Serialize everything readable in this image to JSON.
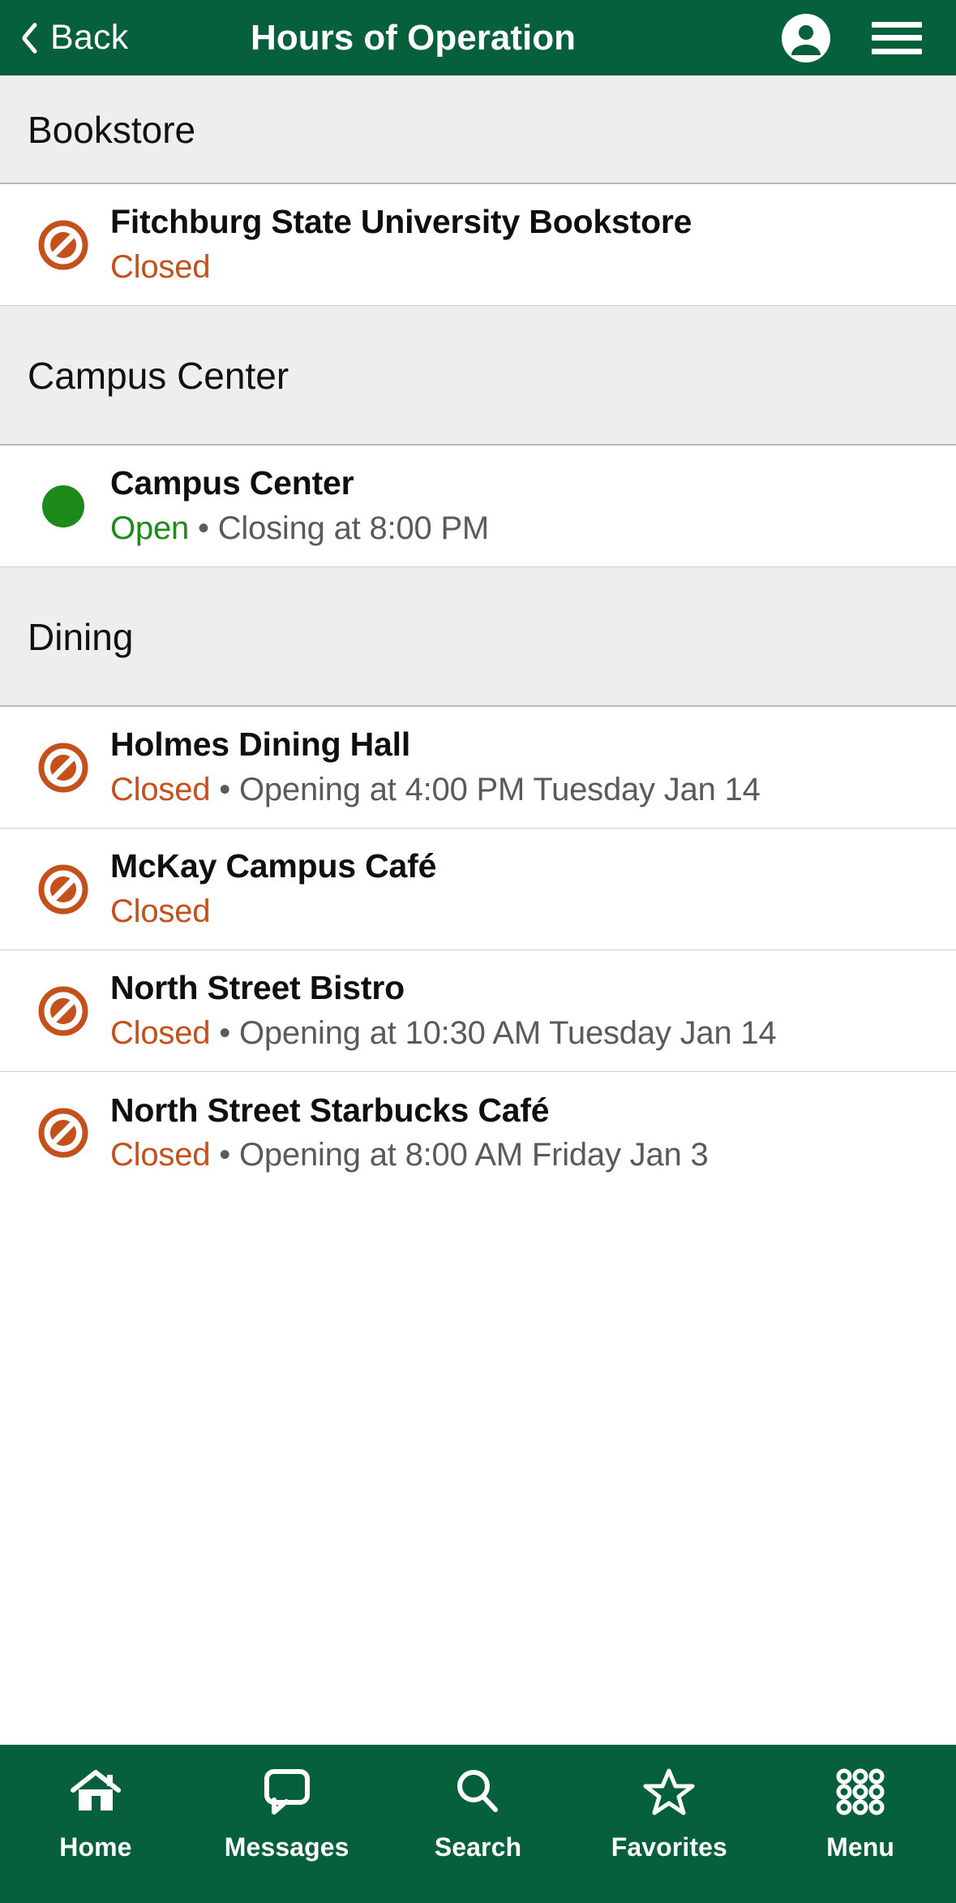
{
  "header": {
    "back_label": "Back",
    "title": "Hours of Operation",
    "account_icon": "account-circle-icon",
    "menu_icon": "hamburger-menu-icon"
  },
  "sections": [
    {
      "title": "Bookstore",
      "items": [
        {
          "name": "Fitchburg State University Bookstore",
          "state_icon": "closed-prohibition-icon",
          "state_label": "Closed",
          "state_type": "closed",
          "detail": ""
        }
      ]
    },
    {
      "title": "Campus Center",
      "items": [
        {
          "name": "Campus Center",
          "state_icon": "open-dot-icon",
          "state_label": "Open",
          "state_type": "open",
          "detail": "Closing at 8:00 PM"
        }
      ]
    },
    {
      "title": "Dining",
      "items": [
        {
          "name": "Holmes Dining Hall",
          "state_icon": "closed-prohibition-icon",
          "state_label": "Closed",
          "state_type": "closed",
          "detail": "Opening at 4:00 PM Tuesday Jan 14"
        },
        {
          "name": "McKay Campus Café",
          "state_icon": "closed-prohibition-icon",
          "state_label": "Closed",
          "state_type": "closed",
          "detail": ""
        },
        {
          "name": "North Street Bistro",
          "state_icon": "closed-prohibition-icon",
          "state_label": "Closed",
          "state_type": "closed",
          "detail": "Opening at 10:30 AM Tuesday Jan 14"
        },
        {
          "name": "North Street Starbucks Café",
          "state_icon": "closed-prohibition-icon",
          "state_label": "Closed",
          "state_type": "closed",
          "detail": "Opening at 8:00 AM Friday Jan 3"
        }
      ]
    }
  ],
  "separator": "•",
  "bottom_nav": [
    {
      "label": "Home",
      "icon": "home-icon"
    },
    {
      "label": "Messages",
      "icon": "message-bubble-icon"
    },
    {
      "label": "Search",
      "icon": "search-icon"
    },
    {
      "label": "Favorites",
      "icon": "star-icon"
    },
    {
      "label": "Menu",
      "icon": "grid-menu-icon"
    }
  ],
  "colors": {
    "brand_green": "#06603c",
    "open_green": "#1c8b19",
    "closed_orange": "#c4501c",
    "section_bg": "#eeeeee",
    "detail_gray": "#5a5a5a"
  }
}
